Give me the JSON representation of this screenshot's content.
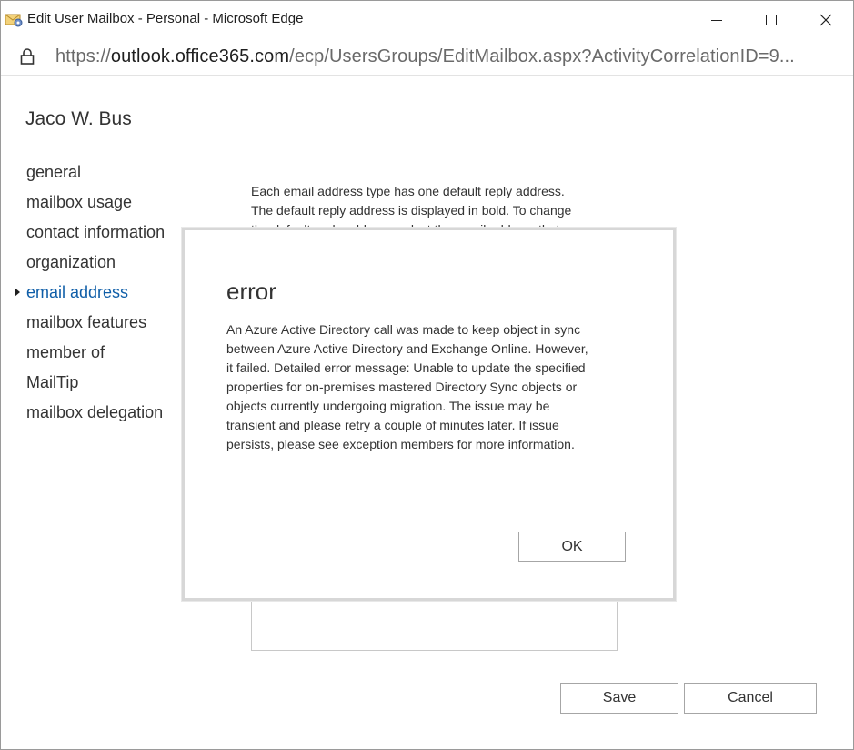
{
  "window": {
    "title": "Edit User Mailbox - Personal - Microsoft Edge",
    "icons": {
      "app": "mail-icon",
      "minimize": "minimize-icon",
      "maximize": "maximize-icon",
      "close": "close-icon"
    }
  },
  "address_bar": {
    "lock_icon": "lock-icon",
    "protocol": "https://",
    "host": "outlook.office365.com",
    "path": "/ecp/UsersGroups/EditMailbox.aspx?ActivityCorrelationID=9..."
  },
  "page": {
    "user_name": "Jaco W. Bus",
    "nav": [
      {
        "label": "general",
        "selected": false
      },
      {
        "label": "mailbox usage",
        "selected": false
      },
      {
        "label": "contact information",
        "selected": false
      },
      {
        "label": "organization",
        "selected": false
      },
      {
        "label": "email address",
        "selected": true
      },
      {
        "label": "mailbox features",
        "selected": false
      },
      {
        "label": "member of",
        "selected": false
      },
      {
        "label": "MailTip",
        "selected": false
      },
      {
        "label": "mailbox delegation",
        "selected": false
      }
    ],
    "description_lines": [
      "Each email address type has one default reply address.",
      "The default reply address is displayed in bold. To change",
      "the default reply address, select the email address that"
    ],
    "save_label": "Save",
    "cancel_label": "Cancel"
  },
  "dialog": {
    "title": "error",
    "message_lines": [
      "An Azure Active Directory call was made to keep object in sync",
      "between Azure Active Directory and Exchange Online. However,",
      "it failed. Detailed error message: Unable to update the specified",
      "properties for on-premises mastered Directory Sync objects or",
      "objects currently undergoing migration. The issue may be",
      "transient and please retry a couple of minutes later. If issue",
      "persists, please see exception members for more information."
    ],
    "ok_label": "OK"
  },
  "colors": {
    "accent": "#0f5ea8",
    "text": "#333333",
    "border": "#a6a6a6"
  }
}
